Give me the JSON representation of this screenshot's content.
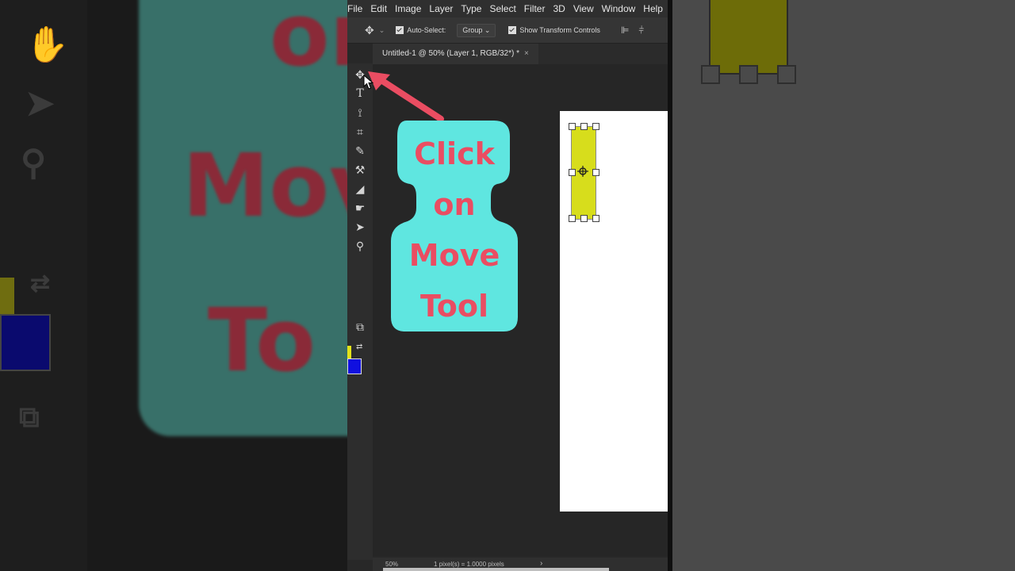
{
  "menu": [
    "File",
    "Edit",
    "Image",
    "Layer",
    "Type",
    "Select",
    "Filter",
    "3D",
    "View",
    "Window",
    "Help"
  ],
  "options_bar": {
    "auto_select_label": "Auto-Select:",
    "group_select_value": "Group",
    "show_transform_label": "Show Transform Controls"
  },
  "document_tab": {
    "title": "Untitled-1 @ 50% (Layer 1, RGB/32*) *",
    "close_glyph": "×"
  },
  "callout": {
    "lines": [
      "Click",
      "on",
      "Move",
      "Tool"
    ],
    "text_color": "#ea4d62",
    "bg_color": "#5fe6e0"
  },
  "colors": {
    "foreground": "#e3e31a",
    "background": "#1010e0",
    "layer_fill": "#d7dd1c"
  },
  "status_bar": {
    "zoom": "50%",
    "pixel_ratio": "1 pixel(s) = 1.0000 pixels",
    "arrow": "›"
  },
  "tools": [
    "move-tool",
    "type-tool",
    "lasso-tool",
    "crop-tool",
    "eyedropper-tool",
    "healing-brush-tool",
    "eraser-tool",
    "smudge-tool",
    "path-selection-tool",
    "zoom-tool",
    "screen-mode"
  ]
}
